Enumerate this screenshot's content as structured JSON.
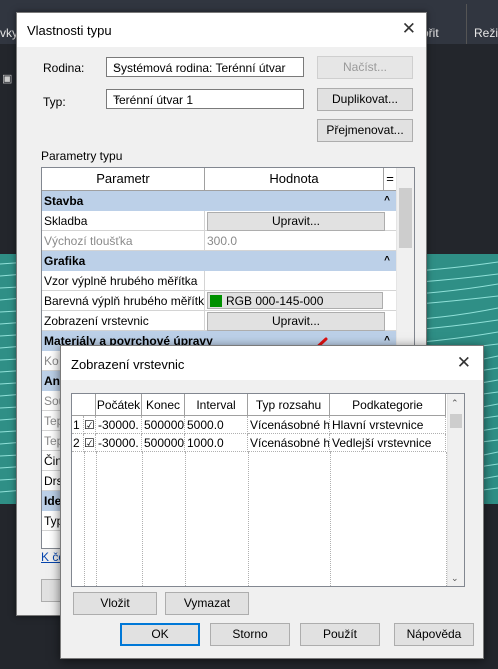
{
  "background": {
    "ribbon_left": "vky",
    "ribbon_mid": "ořit",
    "ribbon_right": "Reži"
  },
  "type_props": {
    "title": "Vlastnosti typu",
    "family_label": "Rodina:",
    "family_value": "Systémová rodina: Terénní útvar",
    "load_button": "Načíst...",
    "type_label": "Typ:",
    "type_value": "Terénní útvar 1",
    "duplicate_button": "Duplikovat...",
    "rename_button": "Přejmenovat...",
    "params_title": "Parametry typu",
    "col_param": "Parametr",
    "col_value": "Hodnota",
    "col_eq": "=",
    "sections": {
      "stavba": "Stavba",
      "grafika": "Grafika",
      "materialy": "Materiály a povrchové úpravy",
      "analyza": "Ana",
      "identita": "Ide"
    },
    "rows": {
      "skladba": "Skladba",
      "skladba_btn": "Upravit...",
      "tloustka": "Výchozí tloušťka",
      "tloustka_val": "300.0",
      "vzor": "Vzor výplně hrubého měřítka",
      "barva": "Barevná výplň hrubého měřítk",
      "barva_val": "RGB 000-145-000",
      "barva_color": "#009100",
      "vrstevnice": "Zobrazení vrstevnic",
      "vrstevnice_btn": "Upravit...",
      "partial_ko": "Ko",
      "partial_sou": "Sou",
      "partial_tep1": "Tep",
      "partial_tep2": "Tep",
      "partial_cin": "Čin",
      "partial_drs": "Drs",
      "partial_typ": "Typ"
    },
    "link_partial": "K če"
  },
  "contours": {
    "title": "Zobrazení vrstevnic",
    "headers": [
      "",
      "Počátek",
      "Konec",
      "Interval",
      "Typ rozsahu",
      "Podkategorie"
    ],
    "rows": [
      {
        "num": "1",
        "checked": "☑",
        "start": "-30000.",
        "end": "500000.",
        "interval": "5000.0",
        "range": "Vícenásobné h",
        "sub": "Hlavní vrstevnice"
      },
      {
        "num": "2",
        "checked": "☑",
        "start": "-30000.",
        "end": "500000.",
        "interval": "1000.0",
        "range": "Vícenásobné h",
        "sub": "Vedlejší vrstevnice"
      }
    ],
    "insert_button": "Vložit",
    "delete_button": "Vymazat",
    "ok_button": "OK",
    "cancel_button": "Storno",
    "apply_button": "Použít",
    "help_button": "Nápověda"
  },
  "colors": {
    "section_bg": "#bcd0e8",
    "arrow": "#e01010",
    "terrain": "#5fbfb4"
  }
}
